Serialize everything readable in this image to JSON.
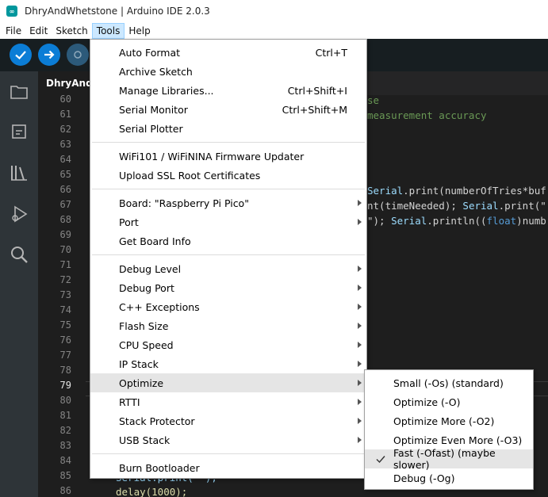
{
  "window": {
    "title": "DhryAndWhetstone | Arduino IDE 2.0.3",
    "app_icon_text": "∞"
  },
  "menubar": [
    {
      "label": "File"
    },
    {
      "label": "Edit"
    },
    {
      "label": "Sketch"
    },
    {
      "label": "Tools"
    },
    {
      "label": "Help"
    }
  ],
  "editor": {
    "tab_label": "DhryAndW",
    "current_line": 79,
    "line_numbers": [
      60,
      61,
      62,
      63,
      64,
      65,
      66,
      67,
      68,
      69,
      70,
      71,
      72,
      73,
      74,
      75,
      76,
      77,
      78,
      79,
      80,
      81,
      82,
      83,
      84,
      85,
      86
    ],
    "code": {
      "l60": "se",
      "l61": "measurement accuracy",
      "l66_a": "Serial",
      "l66_b": ".print(numberOfTries*buf",
      "l67_a": "nt(timeNeeded); ",
      "l67_b": "Serial",
      "l67_c": ".print(\"",
      "l68_a": "\"); ",
      "l68_b": "Serial",
      "l68_c": ".println((",
      "l68_d": "float",
      "l68_e": ")numb",
      "l85": "Serial.print(\"\");",
      "l86": "delay(1000);"
    }
  },
  "tools_menu": {
    "groups": [
      [
        {
          "label": "Auto Format",
          "accel": "Ctrl+T"
        },
        {
          "label": "Archive Sketch"
        },
        {
          "label": "Manage Libraries...",
          "accel": "Ctrl+Shift+I"
        },
        {
          "label": "Serial Monitor",
          "accel": "Ctrl+Shift+M"
        },
        {
          "label": "Serial Plotter"
        }
      ],
      [
        {
          "label": "WiFi101 / WiFiNINA Firmware Updater"
        },
        {
          "label": "Upload SSL Root Certificates"
        }
      ],
      [
        {
          "label": "Board: \"Raspberry Pi Pico\"",
          "submenu": true
        },
        {
          "label": "Port",
          "submenu": true
        },
        {
          "label": "Get Board Info"
        }
      ],
      [
        {
          "label": "Debug Level",
          "submenu": true
        },
        {
          "label": "Debug Port",
          "submenu": true
        },
        {
          "label": "C++ Exceptions",
          "submenu": true
        },
        {
          "label": "Flash Size",
          "submenu": true
        },
        {
          "label": "CPU Speed",
          "submenu": true
        },
        {
          "label": "IP Stack",
          "submenu": true
        },
        {
          "label": "Optimize",
          "submenu": true,
          "highlighted": true
        },
        {
          "label": "RTTI",
          "submenu": true
        },
        {
          "label": "Stack Protector",
          "submenu": true
        },
        {
          "label": "USB Stack",
          "submenu": true
        }
      ],
      [
        {
          "label": "Burn Bootloader"
        }
      ]
    ]
  },
  "optimize_submenu": [
    {
      "label": "Small (-Os) (standard)"
    },
    {
      "label": "Optimize (-O)"
    },
    {
      "label": "Optimize More (-O2)"
    },
    {
      "label": "Optimize Even More (-O3)"
    },
    {
      "label": "Fast (-Ofast) (maybe slower)",
      "checked": true
    },
    {
      "label": "Debug (-Og)"
    }
  ]
}
